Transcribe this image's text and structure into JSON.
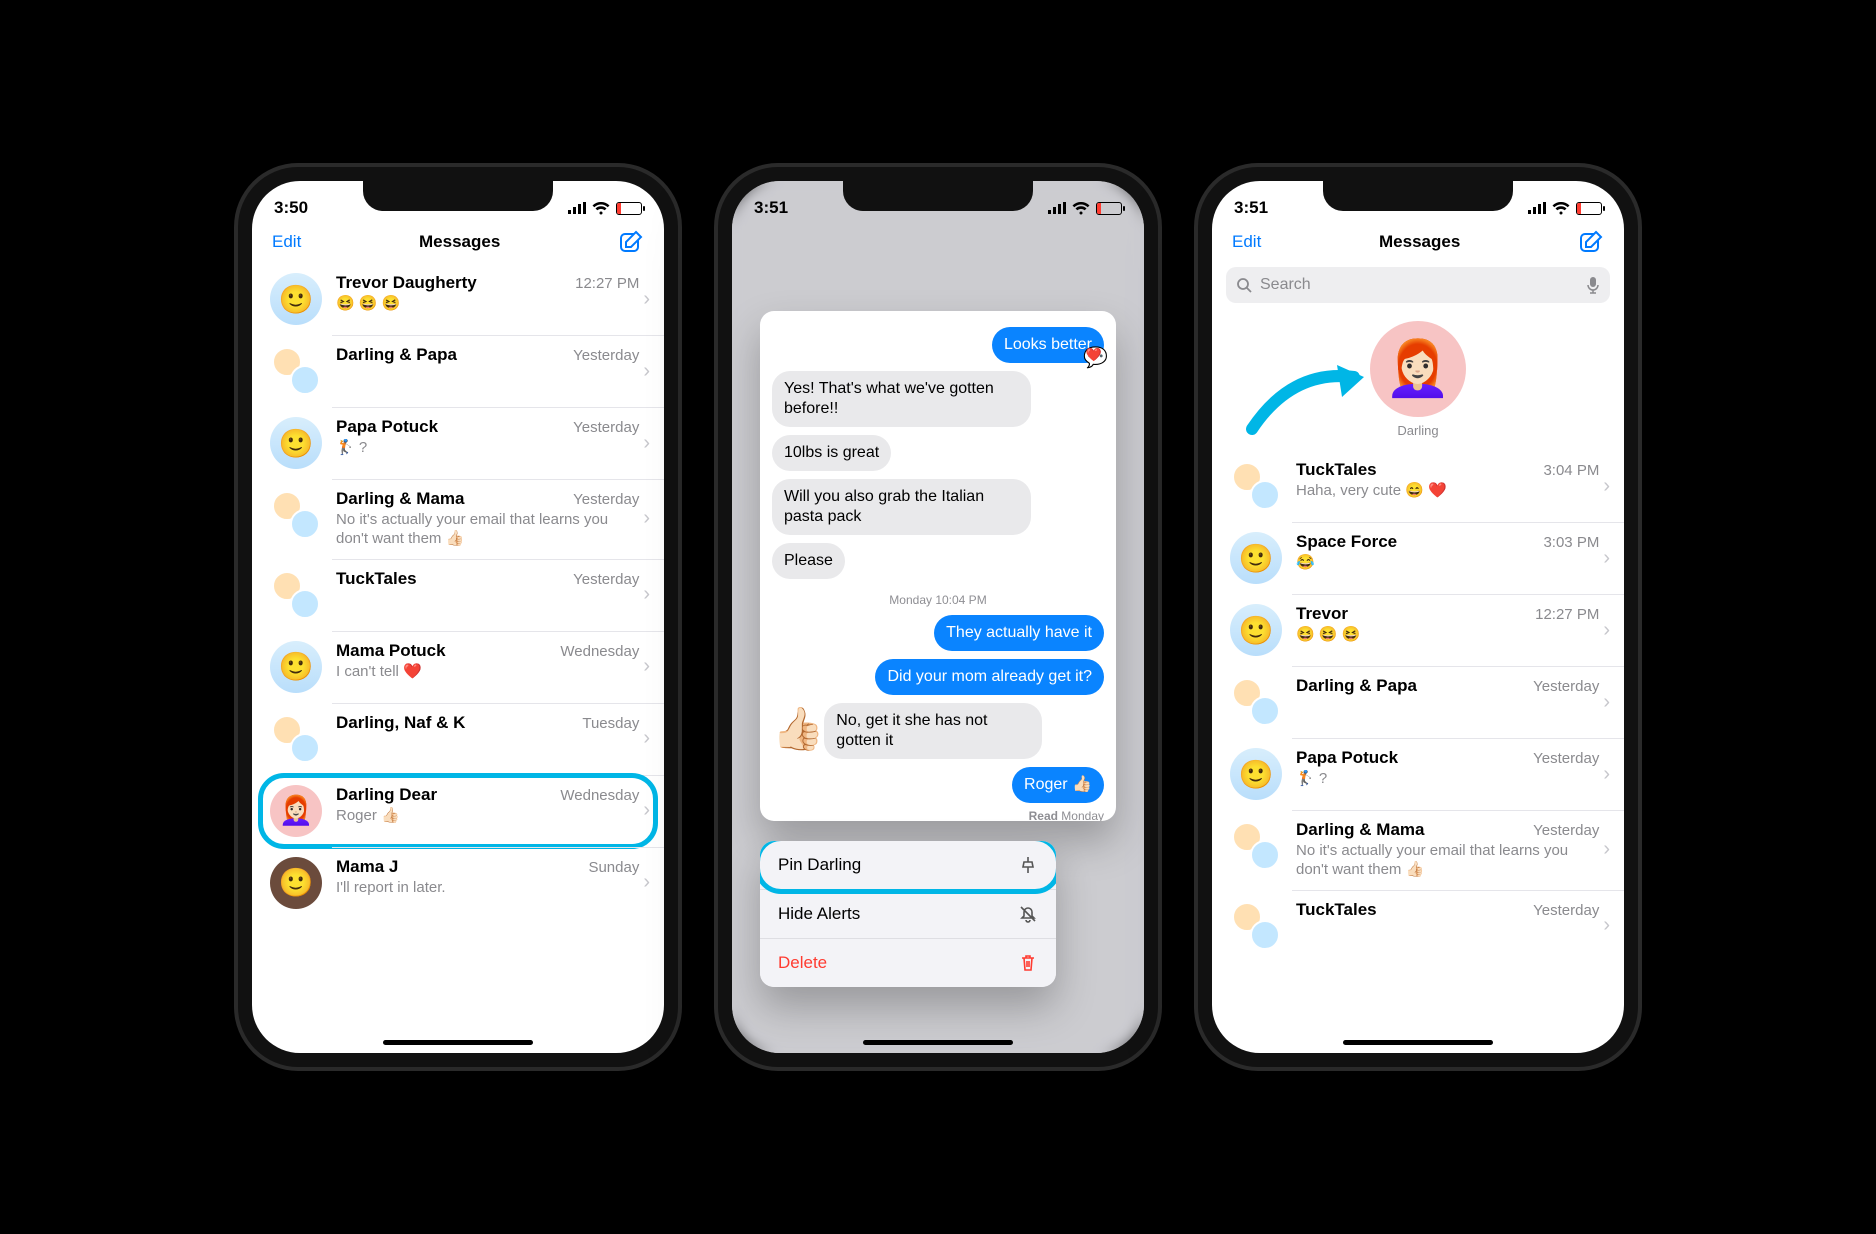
{
  "highlight_color": "#00b6e6",
  "phone1": {
    "status": {
      "time": "3:50"
    },
    "nav": {
      "edit": "Edit",
      "title": "Messages"
    },
    "conversations": [
      {
        "name": "Trevor Daugherty",
        "time": "12:27 PM",
        "preview": "😆 😆 😆",
        "avatar": "memoji"
      },
      {
        "name": "Darling & Papa",
        "time": "Yesterday",
        "preview": "",
        "avatar": "group"
      },
      {
        "name": "Papa Potuck",
        "time": "Yesterday",
        "preview": "🏌️ ?",
        "avatar": "memoji"
      },
      {
        "name": "Darling & Mama",
        "time": "Yesterday",
        "preview": "No it's actually your email that learns you don't want them 👍🏻",
        "avatar": "group"
      },
      {
        "name": "TuckTales",
        "time": "Yesterday",
        "preview": "",
        "avatar": "group"
      },
      {
        "name": "Mama Potuck",
        "time": "Wednesday",
        "preview": "I can't tell ❤️",
        "avatar": "memoji"
      },
      {
        "name": "Darling, Naf & K",
        "time": "Tuesday",
        "preview": "",
        "avatar": "group"
      },
      {
        "name": "Darling Dear",
        "time": "Wednesday",
        "preview": "Roger 👍🏻",
        "avatar": "pink",
        "highlighted": true
      },
      {
        "name": "Mama J",
        "time": "Sunday",
        "preview": "I'll report in later.",
        "avatar": "photo"
      }
    ]
  },
  "phone2": {
    "status": {
      "time": "3:51"
    },
    "preview": {
      "out_top": "Looks better",
      "tapback": "❤️",
      "in1": "Yes! That's what we've gotten before!!",
      "in2": "10lbs is great",
      "in3": "Will you also grab the Italian pasta pack",
      "in4": "Please",
      "timestamp": "Monday 10:04 PM",
      "out1": "They actually have it",
      "out2": "Did your mom already get it?",
      "reaction_thumbs": "👍🏻",
      "in5": "No, get it she has not gotten it",
      "out3": "Roger 👍🏻",
      "read_label": "Read",
      "read_time": "Monday"
    },
    "menu": {
      "pin": "Pin Darling",
      "hide": "Hide Alerts",
      "delete": "Delete"
    }
  },
  "phone3": {
    "status": {
      "time": "3:51"
    },
    "nav": {
      "edit": "Edit",
      "title": "Messages"
    },
    "search": {
      "placeholder": "Search"
    },
    "pinned": {
      "label": "Darling"
    },
    "conversations": [
      {
        "name": "TuckTales",
        "time": "3:04 PM",
        "preview": "Haha, very cute 😄 ❤️",
        "avatar": "group"
      },
      {
        "name": "Space Force",
        "time": "3:03 PM",
        "preview": "😂",
        "avatar": "memoji"
      },
      {
        "name": "Trevor",
        "time": "12:27 PM",
        "preview": "😆 😆 😆",
        "avatar": "memoji"
      },
      {
        "name": "Darling & Papa",
        "time": "Yesterday",
        "preview": "",
        "avatar": "group"
      },
      {
        "name": "Papa Potuck",
        "time": "Yesterday",
        "preview": "🏌️ ?",
        "avatar": "memoji"
      },
      {
        "name": "Darling & Mama",
        "time": "Yesterday",
        "preview": "No it's actually your email that learns you don't want them 👍🏻",
        "avatar": "group"
      },
      {
        "name": "TuckTales",
        "time": "Yesterday",
        "preview": "",
        "avatar": "group"
      }
    ]
  }
}
